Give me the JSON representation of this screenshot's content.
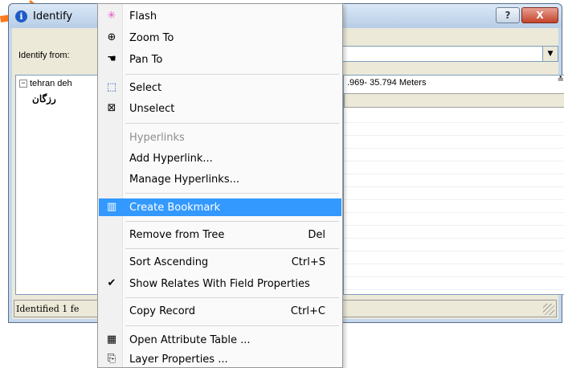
{
  "window": {
    "title": "Identify",
    "help_glyph": "?",
    "close_glyph": "X",
    "identify_from_label": "Identify from:",
    "combo_value": "",
    "tree_root": "tehran deh",
    "tree_child": "رزگان",
    "location_text": ".969- 35.794 Meters",
    "status_text": "Identified 1 fe"
  },
  "menu": {
    "items": [
      {
        "label": "Flash",
        "icon": "flash-icon",
        "shortcut": ""
      },
      {
        "label": "Zoom To",
        "icon": "zoom-to-icon",
        "shortcut": ""
      },
      {
        "label": "Pan To",
        "icon": "pan-hand-icon",
        "shortcut": ""
      },
      {
        "label": "Select",
        "icon": "select-icon",
        "shortcut": ""
      },
      {
        "label": "Unselect",
        "icon": "unselect-icon",
        "shortcut": ""
      },
      {
        "label": "Hyperlinks",
        "icon": "",
        "shortcut": "",
        "disabled": true
      },
      {
        "label": "Add Hyperlink...",
        "icon": "",
        "shortcut": ""
      },
      {
        "label": "Manage Hyperlinks...",
        "icon": "",
        "shortcut": ""
      },
      {
        "label": "Create Bookmark",
        "icon": "bookmark-icon",
        "shortcut": "",
        "highlighted": true
      },
      {
        "label": "Remove from Tree",
        "icon": "",
        "shortcut": "Del"
      },
      {
        "label": "Sort Ascending",
        "icon": "",
        "shortcut": "Ctrl+S"
      },
      {
        "label": "Show Relates With Field Properties",
        "icon": "checkmark-icon",
        "shortcut": ""
      },
      {
        "label": "Copy Record",
        "icon": "",
        "shortcut": "Ctrl+C"
      },
      {
        "label": "Open Attribute Table ...",
        "icon": "table-icon",
        "shortcut": ""
      },
      {
        "label": "Layer Properties ...",
        "icon": "layer-properties-icon",
        "shortcut": ""
      }
    ]
  },
  "colors": {
    "highlight": "#3399ff",
    "accent_orange": "#ff7a1a"
  }
}
